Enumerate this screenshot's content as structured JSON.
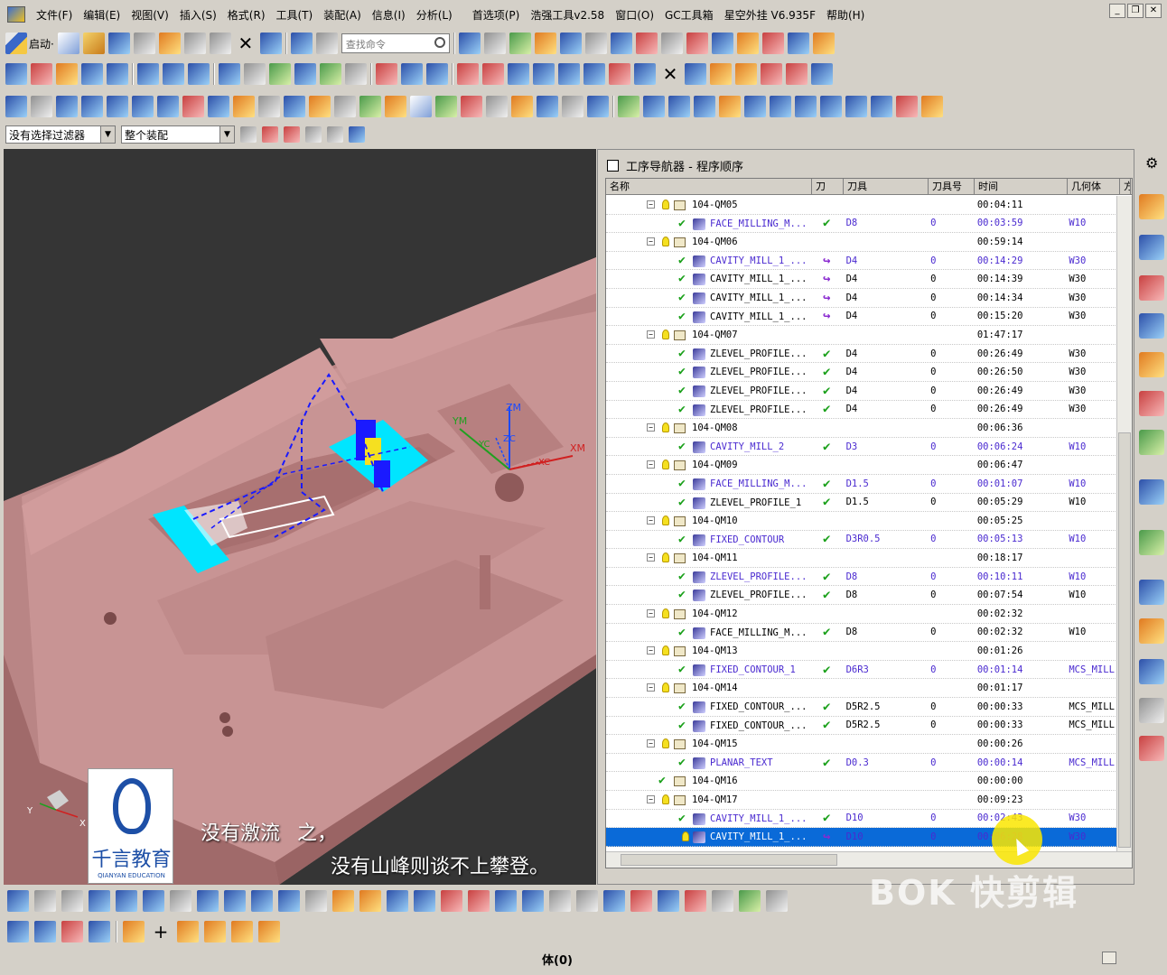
{
  "menubar": {
    "items": [
      "文件(F)",
      "编辑(E)",
      "视图(V)",
      "插入(S)",
      "格式(R)",
      "工具(T)",
      "装配(A)",
      "信息(I)",
      "分析(L)",
      "首选项(P)",
      "浩强工具v2.58",
      "窗口(O)",
      "GC工具箱",
      "星空外挂 V6.935F",
      "帮助(H)"
    ]
  },
  "toolbar": {
    "start_label": "启动·",
    "search_placeholder": "查找命令"
  },
  "filter": {
    "selection_filter": "没有选择过滤器",
    "scope": "整个装配"
  },
  "navigator": {
    "title": "工序导航器 - 程序顺序",
    "columns": [
      "名称",
      "刀",
      "刀具",
      "刀具号",
      "时间",
      "几何体",
      "方"
    ],
    "rows": [
      {
        "kind": "group",
        "name": "104-QM05",
        "time": "00:04:11"
      },
      {
        "kind": "op",
        "name": "FACE_MILLING_M...",
        "path": "ok",
        "tool": "D8",
        "tnum": "0",
        "time": "00:03:59",
        "geo": "W10"
      },
      {
        "kind": "group",
        "name": "104-QM06",
        "time": "00:59:14"
      },
      {
        "kind": "op",
        "name": "CAVITY_MILL_1_...",
        "path": "redo",
        "tool": "D4",
        "tnum": "0",
        "time": "00:14:29",
        "geo": "W30"
      },
      {
        "kind": "op",
        "name": "CAVITY_MILL_1_...",
        "path": "redo",
        "tool": "D4",
        "tnum": "0",
        "time": "00:14:39",
        "geo": "W30",
        "black": true
      },
      {
        "kind": "op",
        "name": "CAVITY_MILL_1_...",
        "path": "redo",
        "tool": "D4",
        "tnum": "0",
        "time": "00:14:34",
        "geo": "W30",
        "black": true
      },
      {
        "kind": "op",
        "name": "CAVITY_MILL_1_...",
        "path": "redo",
        "tool": "D4",
        "tnum": "0",
        "time": "00:15:20",
        "geo": "W30",
        "black": true
      },
      {
        "kind": "group",
        "name": "104-QM07",
        "time": "01:47:17"
      },
      {
        "kind": "op",
        "name": "ZLEVEL_PROFILE...",
        "path": "ok",
        "tool": "D4",
        "tnum": "0",
        "time": "00:26:49",
        "geo": "W30",
        "black": true
      },
      {
        "kind": "op",
        "name": "ZLEVEL_PROFILE...",
        "path": "ok",
        "tool": "D4",
        "tnum": "0",
        "time": "00:26:50",
        "geo": "W30",
        "black": true
      },
      {
        "kind": "op",
        "name": "ZLEVEL_PROFILE...",
        "path": "ok",
        "tool": "D4",
        "tnum": "0",
        "time": "00:26:49",
        "geo": "W30",
        "black": true
      },
      {
        "kind": "op",
        "name": "ZLEVEL_PROFILE...",
        "path": "ok",
        "tool": "D4",
        "tnum": "0",
        "time": "00:26:49",
        "geo": "W30",
        "black": true
      },
      {
        "kind": "group",
        "name": "104-QM08",
        "time": "00:06:36"
      },
      {
        "kind": "op",
        "name": "CAVITY_MILL_2",
        "path": "ok",
        "tool": "D3",
        "tnum": "0",
        "time": "00:06:24",
        "geo": "W10"
      },
      {
        "kind": "group",
        "name": "104-QM09",
        "time": "00:06:47"
      },
      {
        "kind": "op",
        "name": "FACE_MILLING_M...",
        "path": "ok",
        "tool": "D1.5",
        "tnum": "0",
        "time": "00:01:07",
        "geo": "W10"
      },
      {
        "kind": "op",
        "name": "ZLEVEL_PROFILE_1",
        "path": "ok",
        "tool": "D1.5",
        "tnum": "0",
        "time": "00:05:29",
        "geo": "W10",
        "black": true
      },
      {
        "kind": "group",
        "name": "104-QM10",
        "time": "00:05:25"
      },
      {
        "kind": "op",
        "name": "FIXED_CONTOUR",
        "path": "ok",
        "tool": "D3R0.5",
        "tnum": "0",
        "time": "00:05:13",
        "geo": "W10"
      },
      {
        "kind": "group",
        "name": "104-QM11",
        "time": "00:18:17"
      },
      {
        "kind": "op",
        "name": "ZLEVEL_PROFILE...",
        "path": "ok",
        "tool": "D8",
        "tnum": "0",
        "time": "00:10:11",
        "geo": "W10"
      },
      {
        "kind": "op",
        "name": "ZLEVEL_PROFILE...",
        "path": "ok",
        "tool": "D8",
        "tnum": "0",
        "time": "00:07:54",
        "geo": "W10",
        "black": true
      },
      {
        "kind": "group",
        "name": "104-QM12",
        "time": "00:02:32"
      },
      {
        "kind": "op",
        "name": "FACE_MILLING_M...",
        "path": "ok",
        "tool": "D8",
        "tnum": "0",
        "time": "00:02:32",
        "geo": "W10",
        "black": true
      },
      {
        "kind": "group",
        "name": "104-QM13",
        "time": "00:01:26"
      },
      {
        "kind": "op",
        "name": "FIXED_CONTOUR_1",
        "path": "ok",
        "tool": "D6R3",
        "tnum": "0",
        "time": "00:01:14",
        "geo": "MCS_MILL"
      },
      {
        "kind": "group",
        "name": "104-QM14",
        "time": "00:01:17"
      },
      {
        "kind": "op",
        "name": "FIXED_CONTOUR_...",
        "path": "ok",
        "tool": "D5R2.5",
        "tnum": "0",
        "time": "00:00:33",
        "geo": "MCS_MILL",
        "black": true
      },
      {
        "kind": "op",
        "name": "FIXED_CONTOUR_...",
        "path": "ok",
        "tool": "D5R2.5",
        "tnum": "0",
        "time": "00:00:33",
        "geo": "MCS_MILL",
        "black": true
      },
      {
        "kind": "group",
        "name": "104-QM15",
        "time": "00:00:26"
      },
      {
        "kind": "op",
        "name": "PLANAR_TEXT",
        "path": "ok",
        "tool": "D0.3",
        "tnum": "0",
        "time": "00:00:14",
        "geo": "MCS_MILL"
      },
      {
        "kind": "group",
        "name": "104-QM16",
        "time": "00:00:00",
        "noexp": true
      },
      {
        "kind": "group",
        "name": "104-QM17",
        "time": "00:09:23"
      },
      {
        "kind": "op",
        "name": "CAVITY_MILL_1_...",
        "path": "ok",
        "tool": "D10",
        "tnum": "0",
        "time": "00:02:43",
        "geo": "W30"
      },
      {
        "kind": "op",
        "name": "CAVITY_MILL_1_...",
        "path": "redo",
        "tool": "D10",
        "tnum": "0",
        "time": "00:06:28",
        "geo": "W30",
        "selected": true
      }
    ]
  },
  "viewport": {
    "axis_labels": [
      "ZM",
      "YM",
      "XM",
      "ZC",
      "YC",
      "XC"
    ],
    "subtitle_1": "没有激流",
    "subtitle_1b": "之，",
    "subtitle_2": "没有山峰则谈不上攀登。",
    "triad_x": "X",
    "triad_y": "Y"
  },
  "logo": {
    "name": "千言教育",
    "sub": "QIANYAN EDUCATION"
  },
  "watermark": "BOK 快剪辑",
  "statusbar": {
    "text": "体(0)"
  },
  "colors": {
    "part": "#c48d8d",
    "background": "#353535",
    "selection": "#0a6ad8",
    "toolpath": "#1a1aff",
    "cyan": "#00e5ff"
  }
}
